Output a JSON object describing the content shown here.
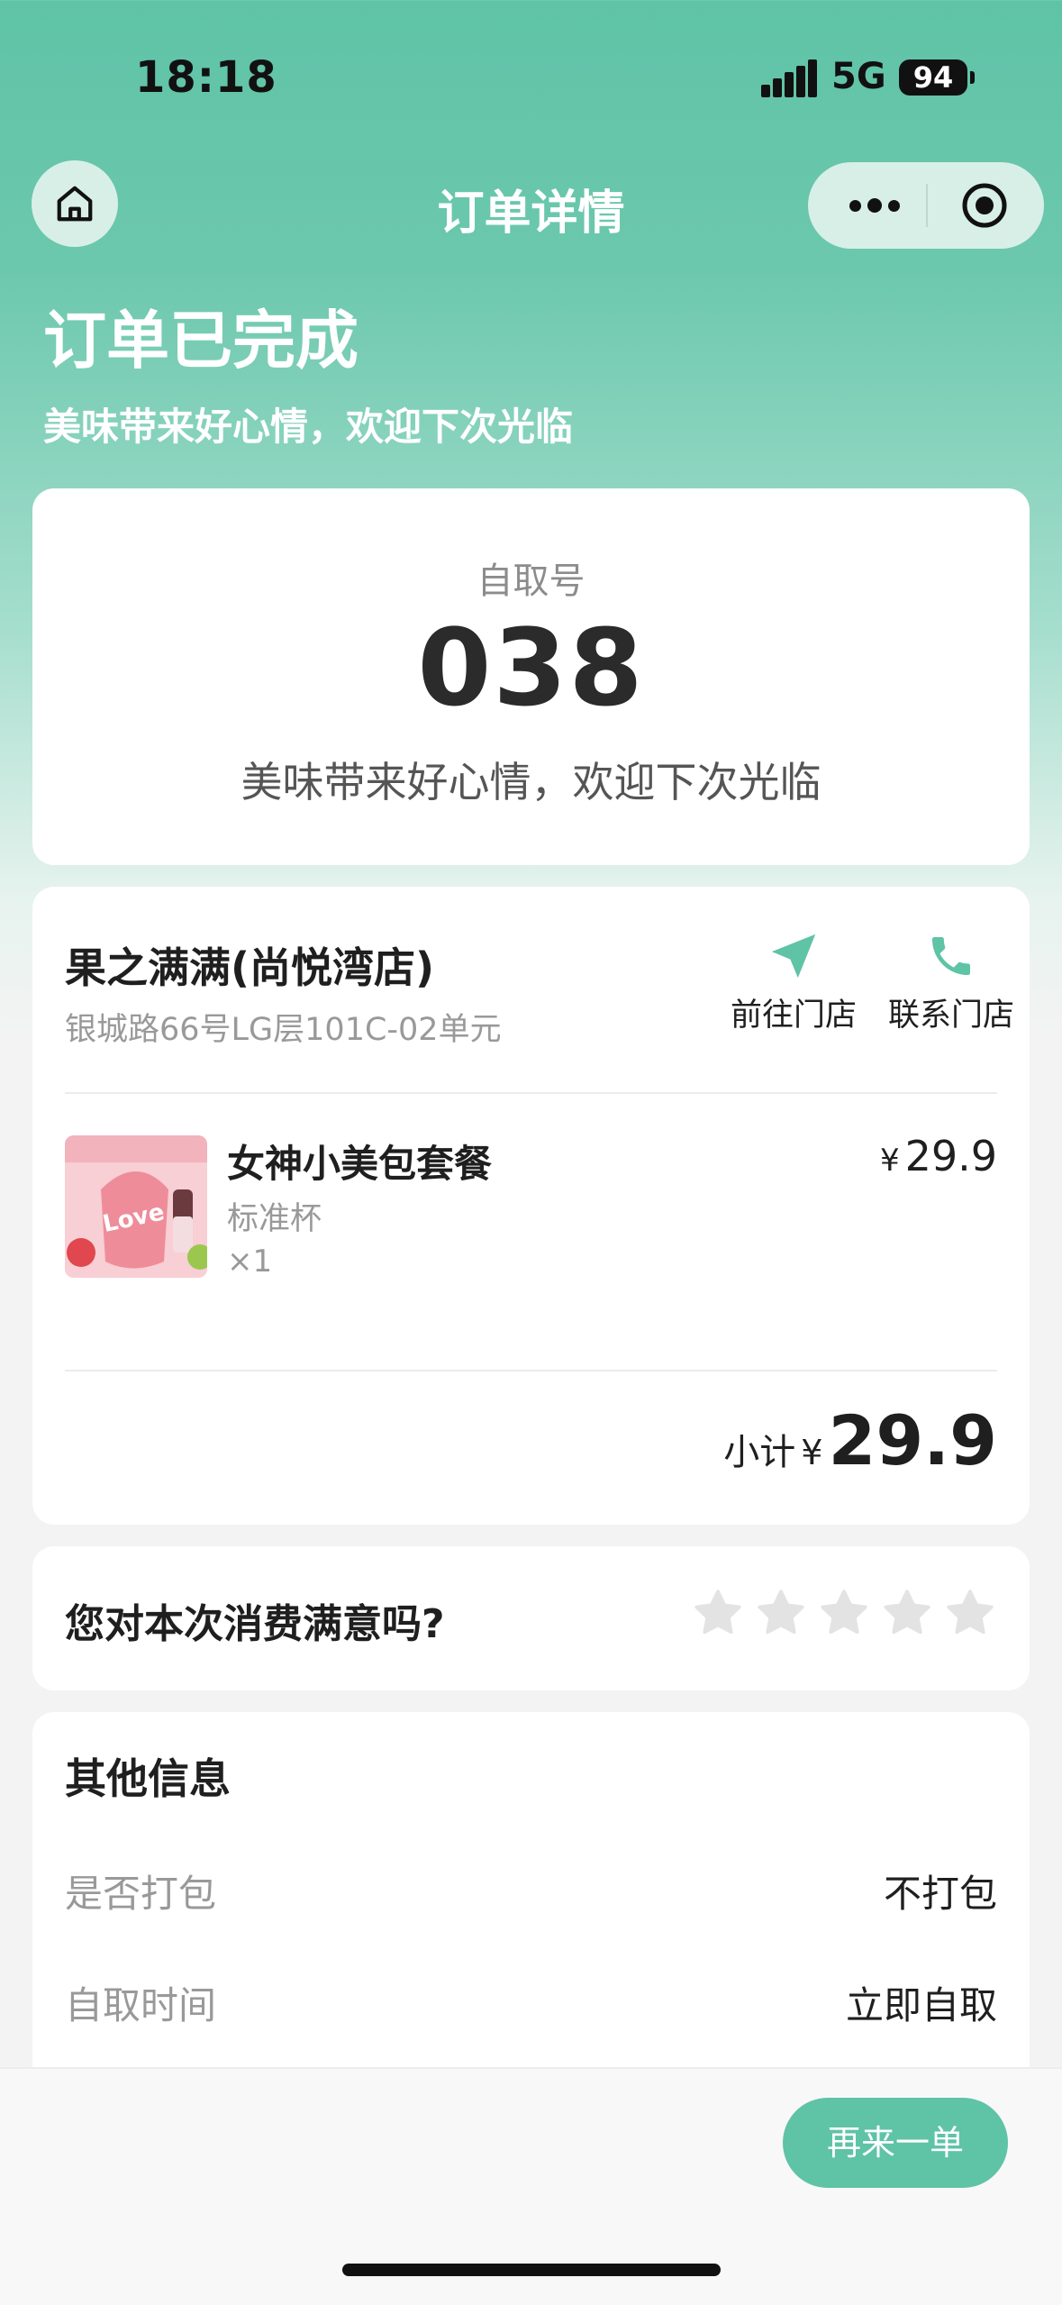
{
  "status_bar": {
    "time": "18:18",
    "network": "5G",
    "battery": "94"
  },
  "nav": {
    "title": "订单详情"
  },
  "order_status": {
    "title": "订单已完成",
    "subtitle": "美味带来好心情，欢迎下次光临"
  },
  "pickup": {
    "label": "自取号",
    "number": "038",
    "message": "美味带来好心情，欢迎下次光临"
  },
  "store": {
    "name": "果之满满(尚悦湾店)",
    "address": "银城路66号LG层101C-02单元",
    "navigate_label": "前往门店",
    "contact_label": "联系门店"
  },
  "product": {
    "name": "女神小美包套餐",
    "spec": "标准杯",
    "quantity": "×1",
    "currency": "¥",
    "price": "29.9",
    "image_text": "Love"
  },
  "subtotal": {
    "label": "小计",
    "currency": "¥",
    "amount": "29.9"
  },
  "rating": {
    "question": "您对本次消费满意吗?",
    "stars_max": 5,
    "stars_selected": 0
  },
  "other_info": {
    "title": "其他信息",
    "rows": [
      {
        "key": "是否打包",
        "value": "不打包"
      },
      {
        "key": "自取时间",
        "value": "立即自取"
      }
    ]
  },
  "actions": {
    "reorder_label": "再来一单"
  },
  "colors": {
    "accent": "#5fc3a6",
    "text": "#1f1f1f",
    "muted": "#999999"
  }
}
